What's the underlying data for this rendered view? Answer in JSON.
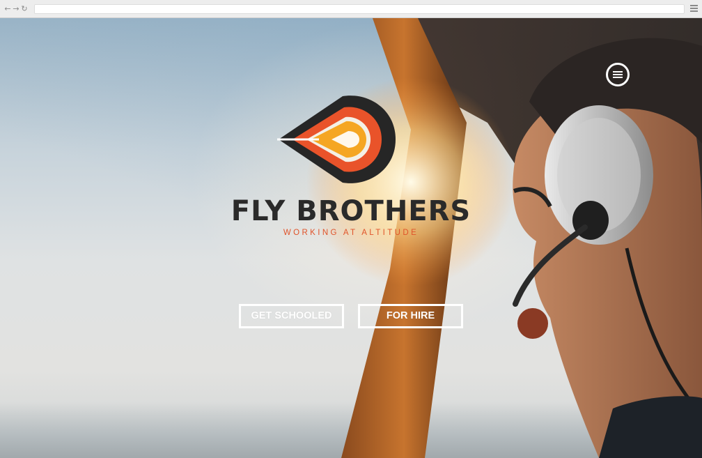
{
  "browser": {
    "nav_icons": [
      "back-arrow-icon",
      "forward-arrow-icon",
      "reload-icon"
    ],
    "url": "",
    "menu_icon": "hamburger-menu-icon"
  },
  "site": {
    "brand_name": "FLY BROTHERS",
    "tagline": "WORKING AT ALTITUDE",
    "logo_icon": "drop-target-logo-icon",
    "menu_icon": "circle-hamburger-icon",
    "buttons": {
      "get_schooled": "GET SCHOOLED",
      "for_hire": "FOR HIRE"
    },
    "colors": {
      "brand_dark": "#2a2a2a",
      "accent_orange": "#e0532a",
      "accent_yellow": "#f5a623",
      "button_border": "#ffffff"
    }
  }
}
